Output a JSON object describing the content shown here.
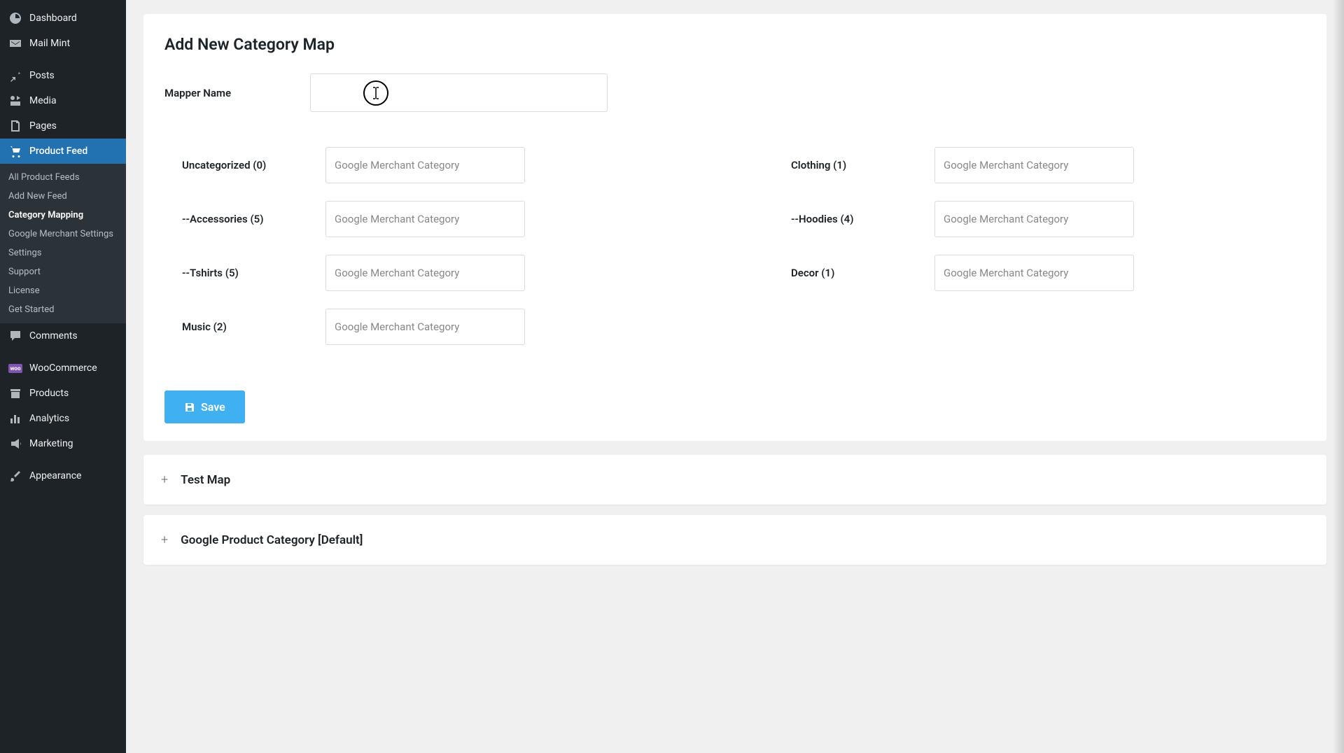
{
  "sidebar": {
    "menu": [
      {
        "icon": "dashboard",
        "label": "Dashboard"
      },
      {
        "icon": "mail",
        "label": "Mail Mint"
      },
      {
        "icon": "pin",
        "label": "Posts"
      },
      {
        "icon": "media",
        "label": "Media"
      },
      {
        "icon": "page",
        "label": "Pages"
      },
      {
        "icon": "cart",
        "label": "Product Feed",
        "active": true
      },
      {
        "icon": "comment",
        "label": "Comments"
      },
      {
        "icon": "woo",
        "label": "WooCommerce"
      },
      {
        "icon": "box",
        "label": "Products"
      },
      {
        "icon": "chart",
        "label": "Analytics"
      },
      {
        "icon": "megaphone",
        "label": "Marketing"
      },
      {
        "icon": "brush",
        "label": "Appearance"
      }
    ],
    "submenu": [
      {
        "label": "All Product Feeds"
      },
      {
        "label": "Add New Feed"
      },
      {
        "label": "Category Mapping",
        "current": true
      },
      {
        "label": "Google Merchant Settings"
      },
      {
        "label": "Settings"
      },
      {
        "label": "Support"
      },
      {
        "label": "License"
      },
      {
        "label": "Get Started"
      }
    ]
  },
  "page": {
    "title": "Add New Category Map",
    "mapperNameLabel": "Mapper Name",
    "mapperNameValue": "",
    "saveLabel": "Save"
  },
  "categories": {
    "placeholder": "Google Merchant Category",
    "left": [
      {
        "label": "Uncategorized (0)"
      },
      {
        "label": "--Accessories (5)"
      },
      {
        "label": "--Tshirts (5)"
      },
      {
        "label": "Music (2)"
      }
    ],
    "right": [
      {
        "label": "Clothing (1)"
      },
      {
        "label": "--Hoodies (4)"
      },
      {
        "label": "Decor (1)"
      }
    ]
  },
  "accordions": [
    {
      "title": "Test Map"
    },
    {
      "title": "Google Product Category [Default]"
    }
  ]
}
